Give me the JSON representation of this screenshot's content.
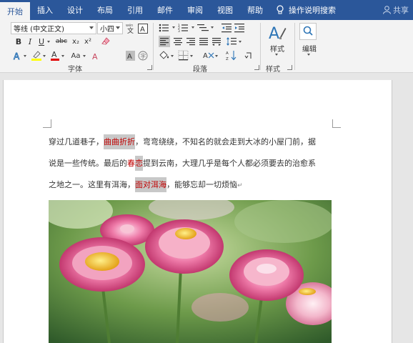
{
  "tabs": {
    "home": "开始",
    "insert": "插入",
    "design": "设计",
    "layout": "布局",
    "references": "引用",
    "mailings": "邮件",
    "review": "审阅",
    "view": "视图",
    "help": "帮助",
    "tell_me": "操作说明搜索",
    "share": "共享"
  },
  "ribbon": {
    "font_name": "等线 (中文正文)",
    "font_size": "小四",
    "font_group_label": "字体",
    "paragraph_group_label": "段落",
    "styles_group_label": "样式",
    "styles_button_label": "样式",
    "editing_button_label": "编辑",
    "bold": "B",
    "italic": "I",
    "underline": "U",
    "strikethrough": "abc",
    "subscript": "x₂",
    "superscript": "x²",
    "change_case": "Aa",
    "char_shading": "A",
    "enclose_char": "字",
    "font_color": "A",
    "text_effects": "A",
    "phonetic_guide": "wén",
    "char_border": "A"
  },
  "document": {
    "line1": {
      "before": "穿过几道巷子，",
      "highlight": "曲曲折折",
      "after": "，弯弯绕绕，不知名的就会走到大冰的小屋门前，据"
    },
    "line2": {
      "before": "说是一些传统。最后的",
      "highlight_a": "春",
      "highlight_b": "恋",
      "after": "提到云南，大理几乎是每个人都必须要去的治愈系"
    },
    "line3": {
      "before": "之地之一。这里有洱海，",
      "highlight": "面对洱海",
      "after": "，能够忘却一切烦恼",
      "pilcrow": "↵"
    }
  },
  "colors": {
    "tab_bar": "#2b579a",
    "highlight_text": "#c00000",
    "highlight_bg": "#c8c8c8"
  }
}
